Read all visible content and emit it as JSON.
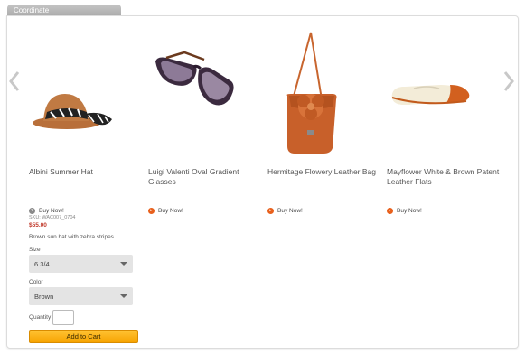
{
  "tab_label": "Coordinate",
  "products": [
    {
      "name": "Albini Summer Hat",
      "buy_label": "Buy Now!",
      "icon": "circle-chevron-down-icon",
      "active": true
    },
    {
      "name": "Luigi Valenti Oval Gradient Glasses",
      "buy_label": "Buy Now!",
      "icon": "circle-chevron-right-icon",
      "active": false
    },
    {
      "name": "Hermitage Flowery Leather Bag",
      "buy_label": "Buy Now!",
      "icon": "circle-chevron-right-icon",
      "active": false
    },
    {
      "name": "Mayflower White & Brown Patent Leather Flats",
      "buy_label": "Buy Now!",
      "icon": "circle-chevron-right-icon",
      "active": false
    }
  ],
  "details": {
    "sku": "SKU: WAC007_0704",
    "price": "$55.00",
    "description": "Brown sun hat with zebra stripes",
    "size_label": "Size",
    "size_value": "6 3/4",
    "color_label": "Color",
    "color_value": "Brown",
    "quantity_label": "Quantity",
    "quantity_value": "",
    "add_to_cart_label": "Add to Cart"
  },
  "colors": {
    "accent_orange": "#e8601c",
    "button_yellow": "#f7a300",
    "price_red": "#c0392b"
  }
}
